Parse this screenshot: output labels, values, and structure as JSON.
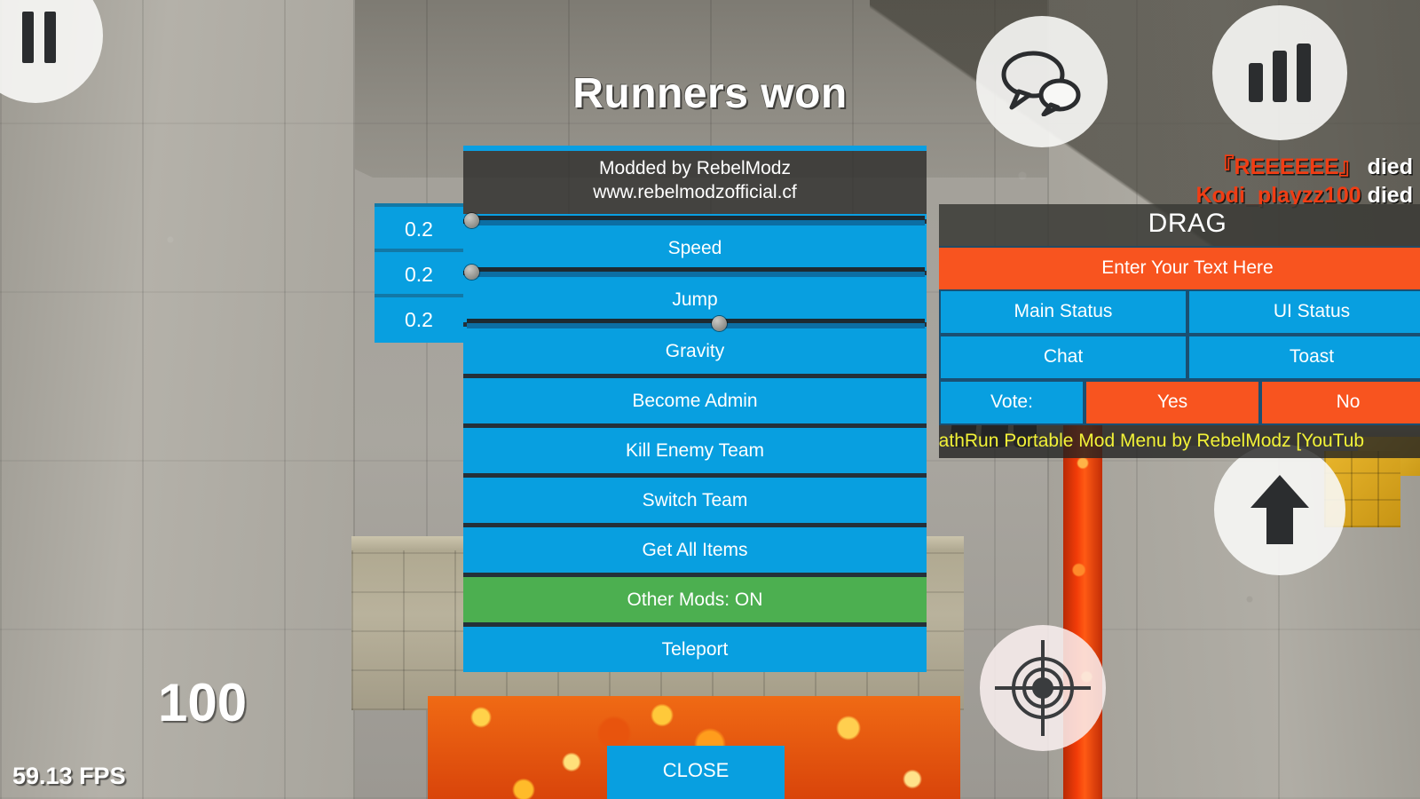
{
  "hud": {
    "round_result": "Runners won",
    "health": "100",
    "fps": "59.13 FPS",
    "pause_icon": "pause-icon",
    "chat_icon": "chat-bubbles-icon",
    "scoreboard_icon": "bar-chart-icon",
    "jump_icon": "up-arrow-icon",
    "aim_icon": "crosshair-icon"
  },
  "killfeed": [
    {
      "player": "『REEEEEE』",
      "action": "died"
    },
    {
      "player": "Kodi_playzz100",
      "action": "died"
    }
  ],
  "mod_menu": {
    "header_line1": "Modded by RebelModz",
    "header_line2": "www.rebelmodzofficial.cf",
    "sliders": [
      {
        "label": "Speed",
        "value": "0.2",
        "position": 1
      },
      {
        "label": "Jump",
        "value": "0.2",
        "position": 1
      },
      {
        "label": "Gravity",
        "value": "0.2",
        "position": 55
      }
    ],
    "buttons": [
      {
        "label": "Become Admin",
        "state": "normal"
      },
      {
        "label": "Kill Enemy Team",
        "state": "normal"
      },
      {
        "label": "Switch Team",
        "state": "normal"
      },
      {
        "label": "Get All Items",
        "state": "normal"
      },
      {
        "label": "Other Mods: ON",
        "state": "on"
      },
      {
        "label": "Teleport",
        "state": "normal"
      }
    ],
    "close_label": "CLOSE"
  },
  "drag_panel": {
    "title": "DRAG",
    "text_input_placeholder": "Enter Your Text Here",
    "text_input_value": "",
    "cells": [
      {
        "label": "Main Status",
        "color": "blue"
      },
      {
        "label": "UI Status",
        "color": "blue"
      },
      {
        "label": "Chat",
        "color": "blue"
      },
      {
        "label": "Toast",
        "color": "blue"
      }
    ],
    "vote_label": "Vote:",
    "vote_yes": "Yes",
    "vote_no": "No",
    "ticker": "eathRun Portable Mod Menu by RebelModz [YouTub"
  },
  "colors": {
    "blue": "#089FE0",
    "green": "#4CAF50",
    "orange": "#F8541F",
    "divider": "#243039",
    "ticker_text": "#F2F238",
    "kill_name": "#F03D14"
  }
}
